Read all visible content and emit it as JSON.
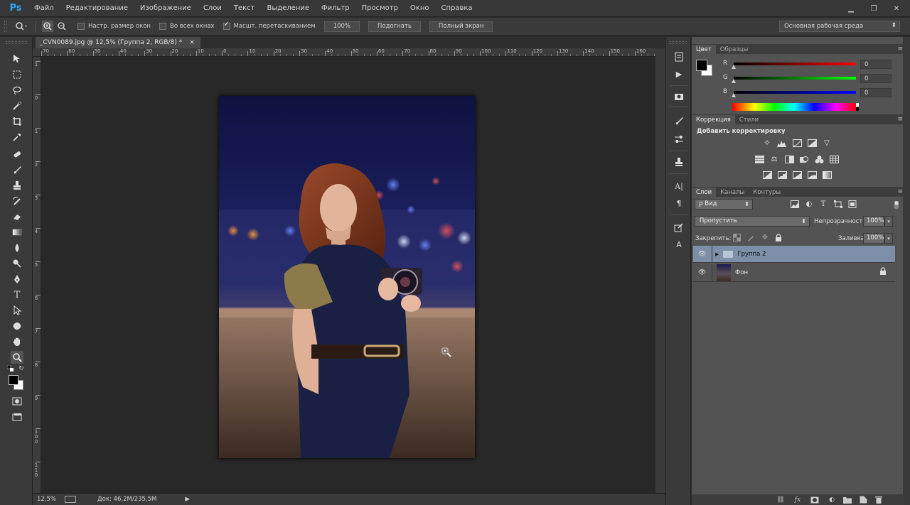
{
  "app": {
    "logo": "Ps"
  },
  "menu": [
    "Файл",
    "Редактирование",
    "Изображение",
    "Слои",
    "Текст",
    "Выделение",
    "Фильтр",
    "Просмотр",
    "Окно",
    "Справка"
  ],
  "window_controls": {
    "minimize": "▁",
    "restore": "❐",
    "close": "✕"
  },
  "options": {
    "resize_windows": "Настр. размер окон",
    "all_windows": "Во всех окнах",
    "scrubby_zoom": "Масшт. перетаскиванием",
    "btn_100": "100%",
    "btn_fit": "Подогнать",
    "btn_fullscreen": "Полный экран",
    "workspace": "Основная рабочая среда"
  },
  "document": {
    "tab_title": "_CVN0089.jpg @ 12,5% (Группа 2, RGB/8) *",
    "tab_close": "×"
  },
  "ruler_h": [
    "70",
    "60",
    "50",
    "40",
    "30",
    "20",
    "10",
    "0",
    "10",
    "20",
    "30",
    "40",
    "50",
    "60",
    "70",
    "80",
    "90",
    "100",
    "110",
    "120",
    "130",
    "140",
    "150",
    "160"
  ],
  "ruler_v": [
    "1",
    "0",
    "1",
    "2",
    "3",
    "4",
    "5",
    "6",
    "7",
    "8",
    "9",
    "1 0 0",
    "1 1 0"
  ],
  "status": {
    "zoom": "12,5%",
    "doc": "Док: 46,2M/235,5M"
  },
  "color_panel": {
    "tabs": [
      "Цвет",
      "Образцы"
    ],
    "r_label": "R",
    "g_label": "G",
    "b_label": "B",
    "r": "0",
    "g": "0",
    "b": "0",
    "fg_color": "#000000",
    "bg_color": "#ffffff"
  },
  "adjustments_panel": {
    "tabs": [
      "Коррекция",
      "Стили"
    ],
    "title": "Добавить корректировку"
  },
  "layers_panel": {
    "tabs": [
      "Слои",
      "Каналы",
      "Контуры"
    ],
    "kind": "ρ Вид",
    "blend_mode": "Пропустить",
    "opacity_label": "Непрозрачность:",
    "opacity": "100%",
    "lock_label": "Закрепить:",
    "fill_label": "Заливка:",
    "fill": "100%",
    "layers": [
      {
        "name": "Группа 2",
        "type": "group",
        "selected": true
      },
      {
        "name": "Фон",
        "type": "image",
        "locked": true
      }
    ]
  }
}
